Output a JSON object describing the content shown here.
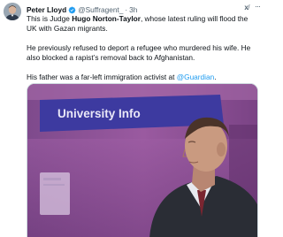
{
  "author": {
    "name": "Peter Lloyd",
    "handle": "@Suffragent_",
    "separator": "·",
    "time": "3h",
    "verified": true,
    "avatar_icon": "user-avatar",
    "verified_icon": "verified-badge-icon"
  },
  "header_actions": {
    "xai_label": "x",
    "xai_slash": "/",
    "more_label": "···"
  },
  "tweet": {
    "p1_pre": "This is Judge ",
    "p1_bold": "Hugo Norton-Taylor",
    "p1_post": ", whose latest ruling will flood the UK with Gazan migrants.",
    "p2": "He previously refused to deport a refugee who murdered his wife. He also blocked a rapist’s removal back to Afghanistan.",
    "p3_pre": "His father was a far-left immigration activist at ",
    "p3_mention": "@Guardian",
    "p3_post": "."
  },
  "media": {
    "banner_text": "University Info",
    "colors": {
      "background": "#8b4f94",
      "banner": "#3d3aa0",
      "suit": "#2a2d35",
      "skin": "#c99a80"
    }
  },
  "colors": {
    "text": "#0f1419",
    "secondary": "#536471",
    "link": "#1d9bf0",
    "verified": "#1d9bf0"
  }
}
